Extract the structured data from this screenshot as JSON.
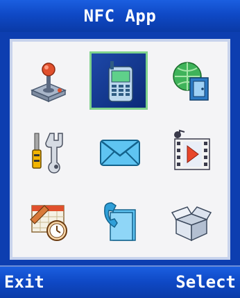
{
  "title": "NFC App",
  "softkeys": {
    "left": "Exit",
    "right": "Select"
  },
  "menu": {
    "selected_index": 1,
    "items": [
      {
        "icon": "joystick-icon"
      },
      {
        "icon": "mobile-phone-icon"
      },
      {
        "icon": "globe-door-icon"
      },
      {
        "icon": "tools-icon"
      },
      {
        "icon": "envelope-icon"
      },
      {
        "icon": "media-player-icon"
      },
      {
        "icon": "calendar-clock-icon"
      },
      {
        "icon": "phone-contacts-icon"
      },
      {
        "icon": "open-box-icon"
      }
    ]
  },
  "colors": {
    "bar": "#0f49c6",
    "selection_border": "#7fd28c",
    "background": "#0d3eb0"
  }
}
